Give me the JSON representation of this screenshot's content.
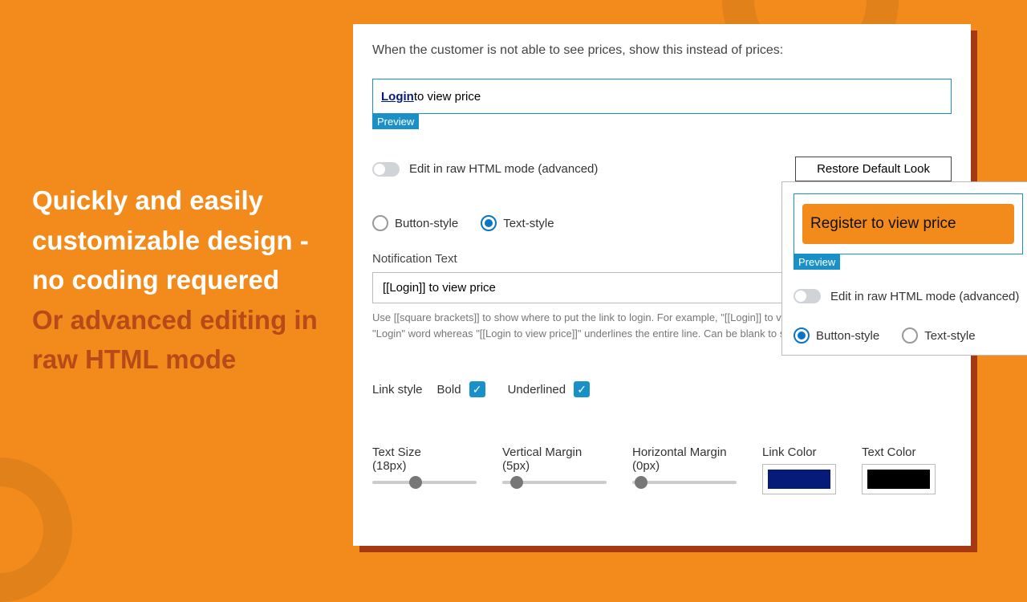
{
  "promo": {
    "line1": "Quickly and easily customizable design - no coding requered",
    "line2": "Or advanced editing in raw HTML mode"
  },
  "settings": {
    "heading": "When the customer is not able to see prices, show this instead of prices:",
    "preview": {
      "login_text": "Login",
      "rest_text": " to view price",
      "tag": "Preview"
    },
    "raw_html_toggle_label": "Edit in raw HTML mode (advanced)",
    "restore_label": "Restore Default Look",
    "style": {
      "button_label": "Button-style",
      "text_label": "Text-style",
      "selected": "text"
    },
    "notification": {
      "label": "Notification Text",
      "value": "[[Login]] to view price",
      "help": "Use [[square brackets]] to show where to put the link to login.\nFor example, \"[[Login]] to view price\" puts the link only on the \"Login\" word whereas \"[[Login to view price]]\" underlines the entire line. Can be blank to show nothing."
    },
    "linkstyle": {
      "label": "Link style",
      "bold": "Bold",
      "underlined": "Underlined"
    },
    "sliders": {
      "text_size": {
        "label": "Text Size",
        "value": "(18px)",
        "pos": 35
      },
      "v_margin": {
        "label": "Vertical Margin",
        "value": "(5px)",
        "pos": 8
      },
      "h_margin": {
        "label": "Horizontal Margin",
        "value": "(0px)",
        "pos": 2
      }
    },
    "colors": {
      "link": {
        "label": "Link Color",
        "hex": "#061a7a"
      },
      "text": {
        "label": "Text Color",
        "hex": "#000000"
      }
    }
  },
  "float": {
    "button_text": "Register to view price",
    "preview_tag": "Preview",
    "raw_html_toggle_label": "Edit in raw HTML mode (advanced)",
    "style": {
      "button_label": "Button-style",
      "text_label": "Text-style",
      "selected": "button"
    }
  }
}
